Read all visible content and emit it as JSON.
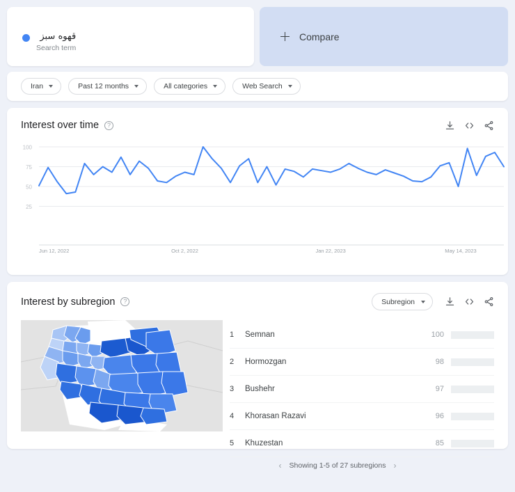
{
  "search": {
    "term": "قهوه سبز",
    "subtitle": "Search term",
    "dot_color": "#4285f4"
  },
  "compare": {
    "label": "Compare",
    "icon": "plus-icon",
    "background": "#d2ddf3"
  },
  "filters": [
    {
      "label": "Iran"
    },
    {
      "label": "Past 12 months"
    },
    {
      "label": "All categories"
    },
    {
      "label": "Web Search"
    }
  ],
  "interest_over_time": {
    "title": "Interest over time",
    "help_icon": "question-mark-icon",
    "actions": [
      "download-icon",
      "embed-icon",
      "share-icon"
    ]
  },
  "interest_by_subregion": {
    "title": "Interest by subregion",
    "help_icon": "question-mark-icon",
    "dropdown_label": "Subregion",
    "actions": [
      "download-icon",
      "embed-icon",
      "share-icon"
    ],
    "footer": "Showing 1-5 of 27 subregions",
    "prev_arrow": "‹",
    "next_arrow": "›",
    "rows": [
      {
        "rank": "1",
        "name": "Semnan",
        "value": 100
      },
      {
        "rank": "2",
        "name": "Hormozgan",
        "value": 98
      },
      {
        "rank": "3",
        "name": "Bushehr",
        "value": 97
      },
      {
        "rank": "4",
        "name": "Khorasan Razavi",
        "value": 96
      },
      {
        "rank": "5",
        "name": "Khuzestan",
        "value": 85
      }
    ]
  },
  "colors": {
    "accent": "#4285f4",
    "page_bg": "#eef1f8",
    "card_bg": "#ffffff",
    "compare_bg": "#d2ddf3",
    "map_land": "#e0e0e0",
    "map_sea": "#ffffff"
  },
  "chart_data": {
    "type": "line",
    "title": "Interest over time",
    "xlabel": "",
    "ylabel": "",
    "ylim": [
      0,
      100
    ],
    "yticks": [
      25,
      50,
      75,
      100
    ],
    "xtick_labels": [
      "Jun 12, 2022",
      "Oct 2, 2022",
      "Jan 22, 2023",
      "May 14, 2023"
    ],
    "xtick_positions": [
      0,
      16,
      32,
      48
    ],
    "grid": true,
    "legend": false,
    "series": [
      {
        "name": "قهوه سبز",
        "color": "#4285f4",
        "values": [
          51,
          74,
          56,
          41,
          43,
          79,
          65,
          75,
          68,
          87,
          65,
          82,
          73,
          57,
          55,
          63,
          68,
          65,
          100,
          85,
          73,
          55,
          76,
          85,
          55,
          75,
          52,
          72,
          69,
          62,
          72,
          70,
          68,
          72,
          79,
          73,
          68,
          65,
          71,
          67,
          63,
          57,
          56,
          62,
          76,
          80,
          50,
          98,
          64,
          88,
          93,
          75
        ]
      }
    ]
  }
}
